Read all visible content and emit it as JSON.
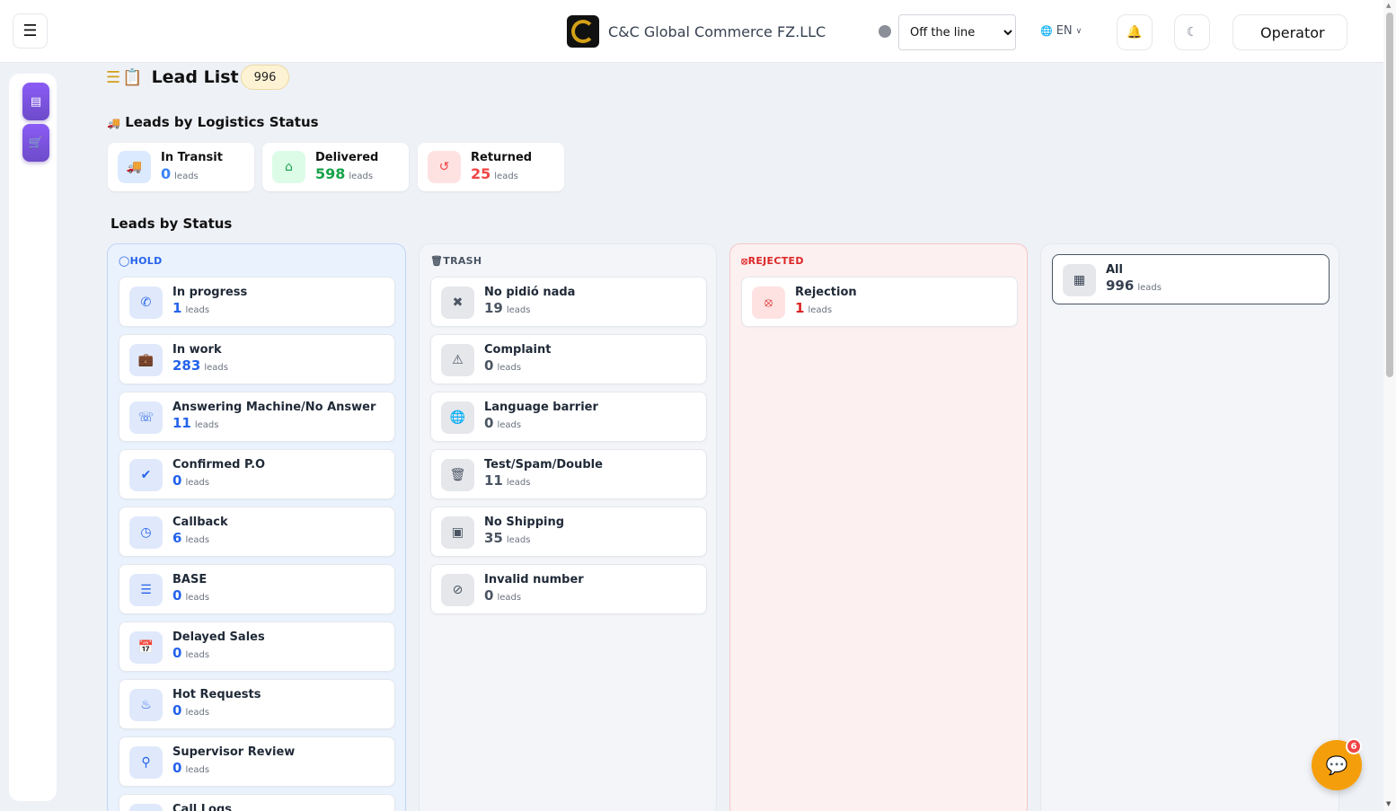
{
  "header": {
    "menu_icon": "hamburger-icon",
    "brand_name": "C&C Global Commerce FZ.LLC",
    "status_selected": "Off the line",
    "status_dot_color": "#8a8f98",
    "language": "EN",
    "operator": "Operator"
  },
  "page": {
    "title": "Lead List",
    "total_count": "996"
  },
  "logistics": {
    "heading": "Leads by Logistics Status",
    "cards": [
      {
        "label": "In Transit",
        "count": "0",
        "unit": "leads",
        "color": "#3b82f6",
        "icon": "truck-icon"
      },
      {
        "label": "Delivered",
        "count": "598",
        "unit": "leads",
        "color": "#16a34a",
        "icon": "home-icon"
      },
      {
        "label": "Returned",
        "count": "25",
        "unit": "leads",
        "color": "#ef4444",
        "icon": "undo-icon"
      }
    ]
  },
  "status": {
    "heading": "Leads by Status",
    "hold": {
      "title": "HOLD",
      "items": [
        {
          "label": "In progress",
          "count": "1",
          "unit": "leads",
          "icon": "phone-icon"
        },
        {
          "label": "In work",
          "count": "283",
          "unit": "leads",
          "icon": "briefcase-icon"
        },
        {
          "label": "Answering Machine/No Answer",
          "count": "11",
          "unit": "leads",
          "icon": "phone-volume-icon"
        },
        {
          "label": "Confirmed P.O",
          "count": "0",
          "unit": "leads",
          "icon": "check-circle-icon"
        },
        {
          "label": "Callback",
          "count": "6",
          "unit": "leads",
          "icon": "clock-icon"
        },
        {
          "label": "BASE",
          "count": "0",
          "unit": "leads",
          "icon": "database-icon"
        },
        {
          "label": "Delayed Sales",
          "count": "0",
          "unit": "leads",
          "icon": "calendar-check-icon"
        },
        {
          "label": "Hot Requests",
          "count": "0",
          "unit": "leads",
          "icon": "fire-icon"
        },
        {
          "label": "Supervisor Review",
          "count": "0",
          "unit": "leads",
          "icon": "search-icon"
        },
        {
          "label": "Call Logs",
          "count": "",
          "unit": "",
          "icon": "list-icon"
        }
      ]
    },
    "trash": {
      "title": "TRASH",
      "items": [
        {
          "label": "No pidió nada",
          "count": "19",
          "unit": "leads",
          "icon": "x-icon"
        },
        {
          "label": "Complaint",
          "count": "0",
          "unit": "leads",
          "icon": "warning-icon"
        },
        {
          "label": "Language barrier",
          "count": "0",
          "unit": "leads",
          "icon": "language-icon"
        },
        {
          "label": "Test/Spam/Double",
          "count": "11",
          "unit": "leads",
          "icon": "trash-icon"
        },
        {
          "label": "No Shipping",
          "count": "35",
          "unit": "leads",
          "icon": "box-icon"
        },
        {
          "label": "Invalid number",
          "count": "0",
          "unit": "leads",
          "icon": "ban-icon"
        }
      ]
    },
    "rejected": {
      "title": "REJECTED",
      "items": [
        {
          "label": "Rejection",
          "count": "1",
          "unit": "leads",
          "icon": "x-circle-icon"
        }
      ]
    },
    "all": {
      "label": "All",
      "count": "996",
      "unit": "leads",
      "icon": "grid-icon"
    }
  },
  "chat": {
    "badge": "6",
    "icon": "chat-icon",
    "color": "#f59e0b"
  }
}
